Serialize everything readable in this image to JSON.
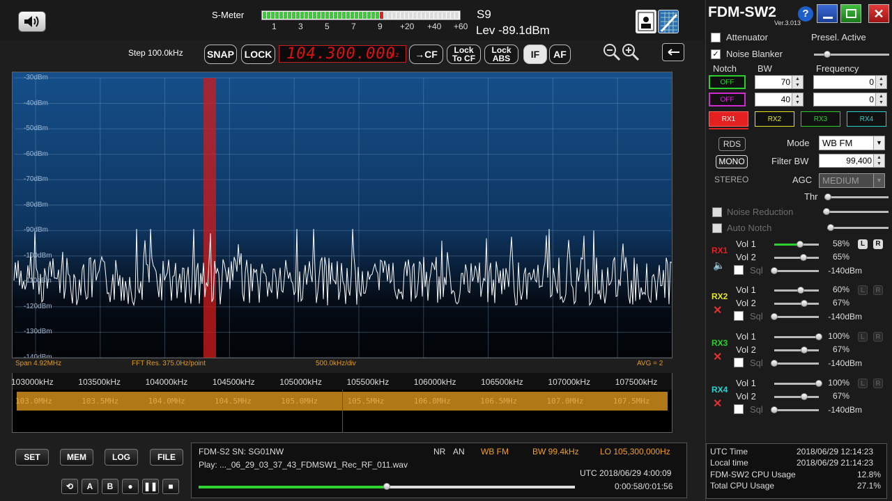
{
  "app": {
    "title": "FDM-SW2",
    "version": "Ver.3.013"
  },
  "smeter": {
    "label": "S-Meter",
    "ticks": [
      "1",
      "3",
      "5",
      "7",
      "9",
      "+20",
      "+40",
      "+60"
    ],
    "level_fraction": 0.61,
    "s_value": "S9",
    "level_text": "Lev -89.1dBm"
  },
  "toolbar": {
    "step": "Step 100.0kHz",
    "snap": "SNAP",
    "lock": "LOCK",
    "frequency": "104.300.000",
    "freq_unit": "Hz",
    "to_cf": "→CF",
    "lock_to_cf_1": "Lock",
    "lock_to_cf_2": "To CF",
    "lock_abs_1": "Lock",
    "lock_abs_2": "ABS",
    "if": "IF",
    "af": "AF"
  },
  "spectrum": {
    "db_labels": [
      "-30dBm",
      "-40dBm",
      "-50dBm",
      "-60dBm",
      "-70dBm",
      "-80dBm",
      "-90dBm",
      "-100dBm",
      "-110dBm",
      "-120dBm",
      "-130dBm",
      "-140dBm"
    ],
    "span": "Span 4.92MHz",
    "fft_res": "FFT Res. 375.0Hz/point",
    "div": "500.0kHz/div",
    "avg": "AVG = 2"
  },
  "freq_axis": [
    "103000kHz",
    "103500kHz",
    "104000kHz",
    "104500kHz",
    "105000kHz",
    "105500kHz",
    "106000kHz",
    "106500kHz",
    "107000kHz",
    "107500kHz"
  ],
  "band_labels": [
    "103.0MHz",
    "103.5MHz",
    "104.0MHz",
    "104.5MHz",
    "105.0MHz",
    "105.5MHz",
    "106.0MHz",
    "106.5MHz",
    "107.0MHz",
    "107.5MHz"
  ],
  "bottom_buttons": {
    "set": "SET",
    "mem": "MEM",
    "log": "LOG",
    "file": "FILE",
    "a": "A",
    "b": "B"
  },
  "status": {
    "device": "FDM-S2 SN: SG01NW",
    "nr": "NR",
    "an": "AN",
    "mode": "WB FM",
    "bw": "BW 99.4kHz",
    "lo": "LO  105,300,000Hz",
    "play": "Play: ..._06_29_03_37_43_FDMSW1_Rec_RF_011.wav",
    "utc": "UTC 2018/06/29 4:00:09",
    "time": "0:00:58/0:01:56",
    "progress_fraction": 0.5
  },
  "right": {
    "attenuator": "Attenuator",
    "presel": "Presel. Active",
    "noise_blanker": "Noise Blanker",
    "notch": "Notch",
    "bw": "BW",
    "frequency": "Frequency",
    "off": "OFF",
    "notch_bw": [
      "70",
      "40"
    ],
    "notch_freq": [
      "0",
      "0"
    ],
    "rx": [
      "RX1",
      "RX2",
      "RX3",
      "RX4"
    ],
    "rds": "RDS",
    "mono": "MONO",
    "stereo": "STEREO",
    "mode_label": "Mode",
    "mode_value": "WB FM",
    "filter_bw_label": "Filter BW",
    "filter_bw_value": "99,400",
    "agc_label": "AGC",
    "agc_value": "MEDIUM",
    "thr": "Thr",
    "noise_reduction": "Noise Reduction",
    "auto_notch": "Auto Notch",
    "vol1": "Vol 1",
    "vol2": "Vol 2",
    "sql": "Sql",
    "L": "L",
    "R": "R",
    "rx_vol1": [
      "58%",
      "60%",
      "100%",
      "100%"
    ],
    "rx_vol2": [
      "65%",
      "67%",
      "67%",
      "67%"
    ],
    "rx_sql": [
      "-140dBm",
      "-140dBm",
      "-140dBm",
      "-140dBm"
    ]
  },
  "sysinfo": {
    "utc_label": "UTC Time",
    "utc_value": "2018/06/29 12:14:23",
    "local_label": "Local time",
    "local_value": "2018/06/29 21:14:23",
    "cpu_label": "FDM-SW2 CPU Usage",
    "cpu_value": "12.8%",
    "total_label": "Total CPU Usage",
    "total_value": "27.1%"
  },
  "colors": {
    "rx1": "#e52020",
    "rx2": "#e6e61e",
    "rx3": "#2ad12a",
    "rx4": "#2ad1d1",
    "accent_orange": "#f0a021"
  }
}
